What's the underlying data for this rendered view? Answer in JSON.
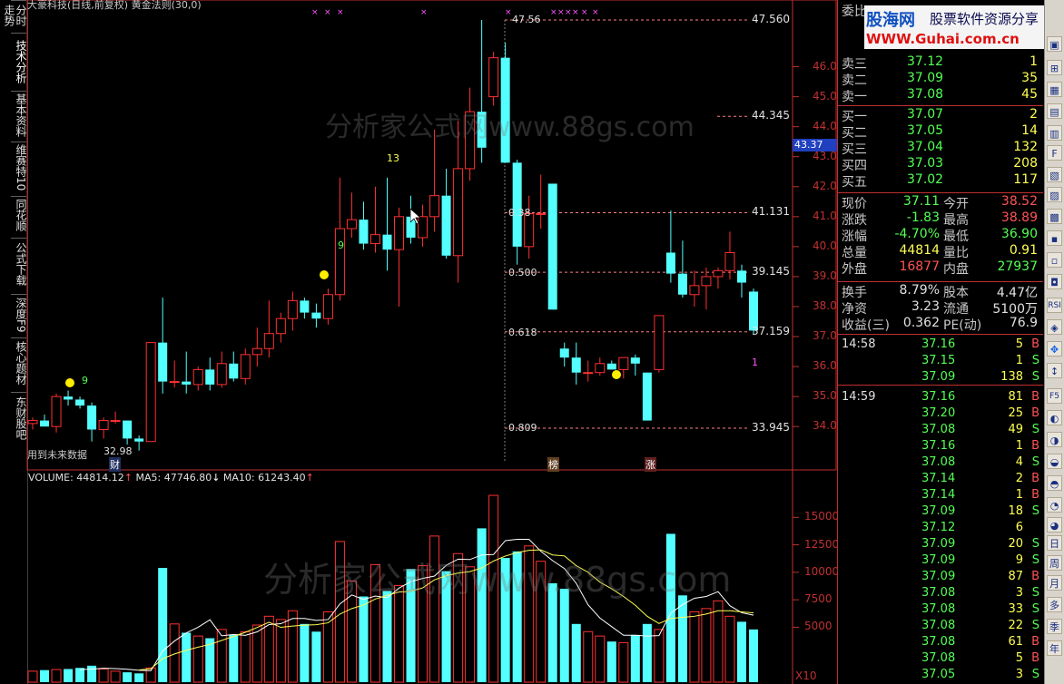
{
  "window": {
    "title": "大豪科技(日线,前复权) 黄金法则(30,0)"
  },
  "left_tabs": [
    "分时走势",
    "技术分析",
    "基本资料",
    "维赛特10",
    "同花顺",
    "公式下载",
    "深度F9",
    "核心题材",
    "东财股吧"
  ],
  "price_axis": [
    "47.560",
    "46.00",
    "45.00",
    "44.345",
    "44.00",
    "43.00",
    "42.00",
    "41.131",
    "41.00",
    "40.00",
    "39.145",
    "39.00",
    "38.00",
    "37.00",
    "37.159",
    "36.00",
    "35.00",
    "34.00",
    "33.945"
  ],
  "current_price_tag": "43.37",
  "price_annotations": {
    "top": "47.56",
    "low": "32.98",
    "fib_38": "0.38",
    "fib_500": "0.500",
    "fib_618": "0.618",
    "fib_809": "0.809",
    "count_9a": "9",
    "count_9b": "9",
    "count_13": "13",
    "count_1": "1"
  },
  "future_note": "用到未来数据",
  "markers": {
    "cai": "财",
    "bang": "榜",
    "zhang": "涨"
  },
  "volume_header": {
    "volume": "VOLUME: 44814.12",
    "ma5": "MA5: 47746.80",
    "ma10": "MA10: 61243.40"
  },
  "volume_axis": [
    "15000",
    "12500",
    "10000",
    "7500",
    "5000",
    "X10"
  ],
  "watermarks": [
    "分析家公式网www.88gs.com",
    "分析家公式网www.88gs.com"
  ],
  "banner": {
    "title": "股海网",
    "subtitle": "股票软件资源分享",
    "url": "WWW.Guhai.com.cn"
  },
  "quote": {
    "header": "委比",
    "asks": [
      {
        "label": "卖三",
        "price": "37.12",
        "vol": "1"
      },
      {
        "label": "卖二",
        "price": "37.09",
        "vol": "35"
      },
      {
        "label": "卖一",
        "price": "37.08",
        "vol": "45"
      }
    ],
    "bids": [
      {
        "label": "买一",
        "price": "37.07",
        "vol": "2"
      },
      {
        "label": "买二",
        "price": "37.05",
        "vol": "14"
      },
      {
        "label": "买三",
        "price": "37.04",
        "vol": "132"
      },
      {
        "label": "买四",
        "price": "37.03",
        "vol": "208"
      },
      {
        "label": "买五",
        "price": "37.02",
        "vol": "117"
      }
    ],
    "stats": [
      {
        "l1": "现价",
        "v1": "37.11",
        "l2": "今开",
        "v2": "38.52"
      },
      {
        "l1": "涨跌",
        "v1": "-1.83",
        "l2": "最高",
        "v2": "38.89"
      },
      {
        "l1": "涨幅",
        "v1": "-4.70%",
        "l2": "最低",
        "v2": "36.90"
      },
      {
        "l1": "总量",
        "v1": "44814",
        "l2": "量比",
        "v2": "0.91"
      },
      {
        "l1": "外盘",
        "v1": "16877",
        "l2": "内盘",
        "v2": "27937"
      }
    ],
    "stats2": [
      {
        "l1": "换手",
        "v1": "8.79%",
        "l2": "股本",
        "v2": "4.47亿"
      },
      {
        "l1": "净资",
        "v1": "3.23",
        "l2": "流通",
        "v2": "5100万"
      },
      {
        "l1": "收益(三)",
        "v1": "0.362",
        "l2": "PE(动)",
        "v2": "76.9"
      }
    ],
    "ticks": [
      {
        "time": "14:58",
        "price": "37.16",
        "vol": "5",
        "side": "B"
      },
      {
        "time": "",
        "price": "37.15",
        "vol": "1",
        "side": "S"
      },
      {
        "time": "",
        "price": "37.09",
        "vol": "138",
        "side": "S"
      },
      {
        "time": "14:59",
        "price": "37.16",
        "vol": "81",
        "side": "B"
      },
      {
        "time": "",
        "price": "37.20",
        "vol": "25",
        "side": "B"
      },
      {
        "time": "",
        "price": "37.08",
        "vol": "49",
        "side": "S"
      },
      {
        "time": "",
        "price": "37.16",
        "vol": "1",
        "side": "B"
      },
      {
        "time": "",
        "price": "37.08",
        "vol": "4",
        "side": "S"
      },
      {
        "time": "",
        "price": "37.14",
        "vol": "2",
        "side": "B"
      },
      {
        "time": "",
        "price": "37.14",
        "vol": "1",
        "side": "B"
      },
      {
        "time": "",
        "price": "37.09",
        "vol": "18",
        "side": "S"
      },
      {
        "time": "",
        "price": "37.12",
        "vol": "6",
        "side": ""
      },
      {
        "time": "",
        "price": "37.09",
        "vol": "20",
        "side": "S"
      },
      {
        "time": "",
        "price": "37.09",
        "vol": "9",
        "side": "S"
      },
      {
        "time": "",
        "price": "37.09",
        "vol": "87",
        "side": "B"
      },
      {
        "time": "",
        "price": "37.08",
        "vol": "3",
        "side": "S"
      },
      {
        "time": "",
        "price": "37.08",
        "vol": "33",
        "side": "S"
      },
      {
        "time": "",
        "price": "37.08",
        "vol": "22",
        "side": "S"
      },
      {
        "time": "",
        "price": "37.08",
        "vol": "61",
        "side": "B"
      },
      {
        "time": "",
        "price": "37.08",
        "vol": "5",
        "side": "B"
      },
      {
        "time": "",
        "price": "37.05",
        "vol": "3",
        "side": "S"
      }
    ]
  },
  "toolbar": [
    "RSI",
    "F5",
    "日",
    "周",
    "月",
    "多",
    "季",
    "年"
  ],
  "chart_data": {
    "type": "candlestick",
    "ohlc": [
      [
        34.1,
        34.3,
        33.9,
        34.2
      ],
      [
        34.2,
        34.4,
        34.0,
        34.0
      ],
      [
        34.0,
        35.1,
        33.8,
        35.0
      ],
      [
        35.0,
        35.2,
        34.7,
        34.9
      ],
      [
        34.9,
        35.0,
        34.6,
        34.7
      ],
      [
        34.7,
        34.8,
        33.5,
        33.9
      ],
      [
        33.9,
        34.3,
        33.6,
        34.2
      ],
      [
        34.2,
        34.5,
        34.1,
        34.2
      ],
      [
        34.2,
        34.2,
        33.4,
        33.6
      ],
      [
        33.6,
        33.7,
        33.2,
        33.5
      ],
      [
        33.5,
        36.8,
        33.5,
        36.8
      ],
      [
        36.8,
        38.3,
        35.1,
        35.5
      ],
      [
        35.5,
        36.2,
        35.3,
        35.5
      ],
      [
        35.5,
        36.5,
        35.1,
        35.4
      ],
      [
        35.4,
        36.0,
        35.2,
        35.9
      ],
      [
        35.9,
        36.3,
        35.2,
        35.4
      ],
      [
        35.4,
        36.5,
        35.3,
        36.1
      ],
      [
        36.1,
        36.5,
        35.5,
        35.6
      ],
      [
        35.6,
        36.6,
        35.4,
        36.4
      ],
      [
        36.4,
        37.3,
        36.0,
        36.6
      ],
      [
        36.6,
        38.2,
        36.3,
        37.1
      ],
      [
        37.1,
        37.8,
        36.8,
        37.6
      ],
      [
        37.6,
        38.5,
        37.2,
        38.2
      ],
      [
        38.2,
        38.3,
        37.6,
        37.8
      ],
      [
        37.8,
        38.1,
        37.3,
        37.6
      ],
      [
        37.6,
        38.6,
        37.4,
        38.4
      ],
      [
        38.4,
        42.3,
        38.2,
        40.6
      ],
      [
        40.6,
        41.8,
        40.3,
        40.9
      ],
      [
        40.9,
        41.5,
        39.9,
        40.1
      ],
      [
        40.1,
        42.0,
        39.8,
        40.4
      ],
      [
        40.4,
        42.3,
        39.2,
        39.9
      ],
      [
        39.9,
        41.3,
        38.0,
        41.0
      ],
      [
        41.0,
        41.7,
        40.1,
        40.3
      ],
      [
        40.3,
        41.4,
        40.0,
        41.0
      ],
      [
        41.0,
        43.9,
        40.5,
        41.7
      ],
      [
        41.7,
        42.6,
        39.6,
        39.7
      ],
      [
        39.7,
        44.2,
        38.8,
        42.6
      ],
      [
        42.6,
        45.3,
        42.2,
        44.5
      ],
      [
        44.5,
        47.56,
        42.8,
        43.3
      ],
      [
        45.0,
        46.5,
        44.7,
        46.3
      ],
      [
        46.3,
        46.8,
        42.8,
        42.8
      ],
      [
        42.8,
        42.9,
        39.4,
        40.0
      ],
      [
        40.0,
        41.7,
        39.6,
        41.1
      ],
      [
        41.1,
        42.4,
        40.6,
        41.1
      ],
      [
        42.1,
        42.1,
        37.9,
        37.9
      ],
      [
        36.6,
        36.8,
        36.0,
        36.3
      ],
      [
        36.3,
        36.8,
        35.4,
        35.8
      ],
      [
        35.8,
        36.2,
        35.5,
        35.8
      ],
      [
        35.8,
        36.3,
        35.7,
        36.1
      ],
      [
        36.1,
        36.2,
        35.9,
        35.9
      ],
      [
        35.9,
        36.2,
        35.6,
        36.3
      ],
      [
        36.3,
        36.4,
        35.7,
        36.1
      ],
      [
        35.8,
        35.8,
        34.2,
        34.2
      ],
      [
        35.9,
        37.7,
        35.8,
        37.7
      ],
      [
        39.8,
        41.2,
        38.8,
        39.1
      ],
      [
        39.1,
        40.2,
        38.3,
        38.4
      ],
      [
        38.4,
        39.2,
        38.0,
        38.7
      ],
      [
        38.7,
        39.3,
        37.9,
        39.0
      ],
      [
        39.0,
        39.3,
        38.6,
        39.2
      ],
      [
        39.2,
        40.5,
        38.9,
        39.8
      ],
      [
        39.2,
        39.4,
        38.3,
        38.8
      ],
      [
        38.5,
        38.6,
        37.1,
        37.2
      ]
    ],
    "volume": [
      1000,
      1100,
      1150,
      1200,
      1300,
      1500,
      1200,
      1000,
      900,
      800,
      1300,
      10400,
      5300,
      4500,
      4200,
      4000,
      4800,
      4300,
      4600,
      5200,
      6000,
      5700,
      6500,
      5300,
      4600,
      6400,
      12800,
      9200,
      7800,
      10700,
      8300,
      8800,
      10300,
      10600,
      13300,
      10100,
      11700,
      10500,
      14000,
      17000,
      11300,
      11900,
      12400,
      11000,
      9000,
      8500,
      5300,
      4600,
      4200,
      3700,
      3600,
      4300,
      5300,
      4800,
      13500,
      7900,
      6400,
      6700,
      7400,
      6000,
      5500,
      4800
    ],
    "ma5": [
      null,
      null,
      null,
      null,
      1150,
      1190,
      1270,
      1240,
      1180,
      1080,
      1040,
      2840,
      3740,
      4480,
      5000,
      5680,
      4220,
      4340,
      4260,
      4580,
      5240,
      5320,
      5800,
      5800,
      5620,
      5700,
      7120,
      7940,
      7520,
      7840,
      7680,
      8560,
      9160,
      9440,
      9660,
      10640,
      11200,
      11160,
      11580,
      11620,
      12880,
      13000,
      13000,
      11920,
      11060,
      10340,
      9000,
      7040,
      5840,
      5050,
      4270,
      4270,
      4200,
      4240,
      6280,
      7060,
      7640,
      7800,
      8240,
      6960,
      6320,
      6100
    ],
    "ma10": [
      null,
      null,
      null,
      null,
      null,
      null,
      null,
      null,
      null,
      1115,
      1220,
      2140,
      2570,
      2900,
      3190,
      3440,
      3800,
      4170,
      4540,
      4980,
      5450,
      4990,
      5110,
      5190,
      5230,
      5400,
      6200,
      6700,
      7020,
      7570,
      7900,
      8200,
      8270,
      8580,
      9310,
      9690,
      9930,
      10060,
      10400,
      11020,
      11480,
      11790,
      12000,
      12040,
      11580,
      11490,
      10600,
      10000,
      9100,
      8500,
      7800,
      7000,
      6000,
      5340,
      5800,
      5900,
      6000,
      6200,
      6500,
      6500,
      6400,
      6300
    ],
    "fib_levels": [
      {
        "ratio": "0.38",
        "price": 41.131
      },
      {
        "ratio": "0.500",
        "price": 39.145
      },
      {
        "ratio": "0.618",
        "price": 37.159
      },
      {
        "ratio": "0.809",
        "price": 33.945
      }
    ],
    "ylim": [
      32.5,
      48.0
    ],
    "vol_ylim": [
      0,
      17500
    ]
  }
}
